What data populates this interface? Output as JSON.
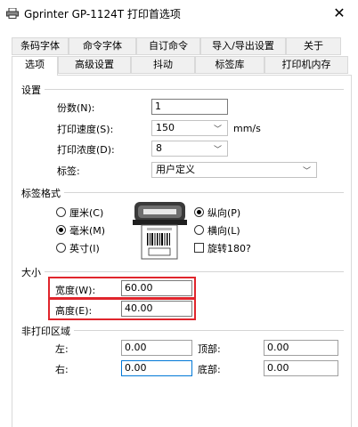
{
  "window": {
    "title": "Gprinter  GP-1124T 打印首选项",
    "close": "✕"
  },
  "tabs": {
    "row1": [
      "条码字体",
      "命令字体",
      "自订命令",
      "导入/导出设置",
      "关于"
    ],
    "row2": [
      "选项",
      "高级设置",
      "抖动",
      "标签库",
      "打印机内存"
    ],
    "active": "选项"
  },
  "settings": {
    "group": "设置",
    "copies_label": "份数(N):",
    "copies_value": "1",
    "speed_label": "打印速度(S):",
    "speed_value": "150",
    "speed_unit": "mm/s",
    "density_label": "打印浓度(D):",
    "density_value": "8",
    "label_label": "标签:",
    "label_value": "用户定义"
  },
  "label_format": {
    "group": "标签格式",
    "unit_cm": "厘米(C)",
    "unit_mm": "毫米(M)",
    "unit_inch": "英寸(I)",
    "selected_unit": "毫米(M)",
    "portrait": "纵向(P)",
    "landscape": "横向(L)",
    "selected_orientation": "纵向(P)",
    "rotate": "旋转180?",
    "rotate_checked": false
  },
  "size": {
    "group": "大小",
    "width_label": "宽度(W):",
    "width_value": "60.00",
    "height_label": "高度(E):",
    "height_value": "40.00"
  },
  "non_print": {
    "group": "非打印区域",
    "left_label": "左:",
    "left_value": "0.00",
    "top_label": "顶部:",
    "top_value": "0.00",
    "right_label": "右:",
    "right_value": "0.00",
    "bottom_label": "底部:",
    "bottom_value": "0.00"
  },
  "colors": {
    "highlight_box": "#e0252c",
    "focus_border": "#0078d7"
  }
}
